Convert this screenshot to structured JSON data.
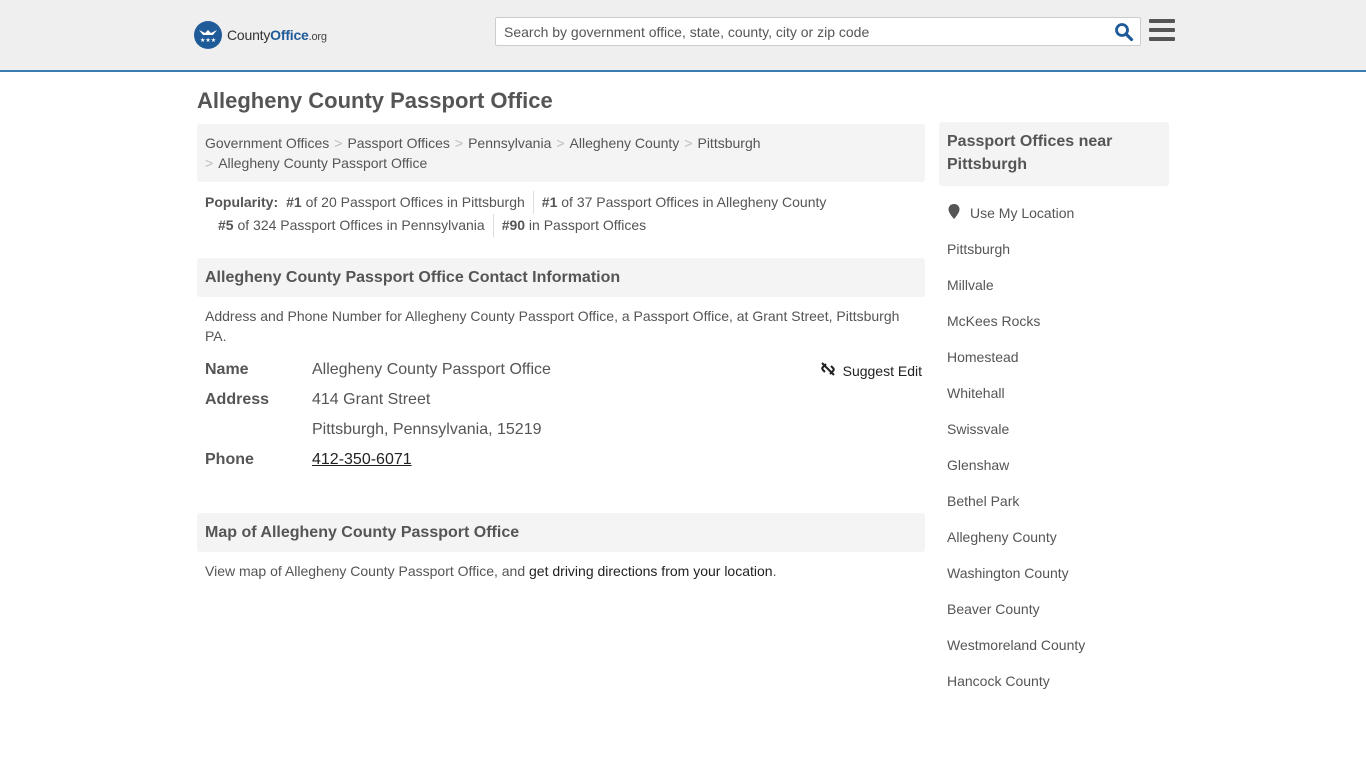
{
  "header": {
    "logo": {
      "prefix": "County",
      "bold": "Office",
      "tld": ".org"
    },
    "search_placeholder": "Search by government office, state, county, city or zip code",
    "search_value": "",
    "search_icon": "search-icon",
    "menu_icon": "hamburger-menu-icon",
    "accent_color": "#3a7bb0"
  },
  "page": {
    "title": "Allegheny County Passport Office"
  },
  "breadcrumb": [
    "Government Offices",
    "Passport Offices",
    "Pennsylvania",
    "Allegheny County",
    "Pittsburgh",
    "Allegheny County Passport Office"
  ],
  "popularity": {
    "label": "Popularity:",
    "items": [
      {
        "rank": "#1",
        "text": " of 20 Passport Offices in Pittsburgh"
      },
      {
        "rank": "#1",
        "text": " of 37 Passport Offices in Allegheny County"
      },
      {
        "rank": "#5",
        "text": " of 324 Passport Offices in Pennsylvania"
      },
      {
        "rank": "#90",
        "text": " in Passport Offices"
      }
    ]
  },
  "contact": {
    "heading": "Allegheny County Passport Office Contact Information",
    "description": "Address and Phone Number for Allegheny County Passport Office, a Passport Office, at Grant Street, Pittsburgh PA.",
    "suggest_edit": "Suggest Edit",
    "rows": {
      "name_label": "Name",
      "name_value": "Allegheny County Passport Office",
      "address_label": "Address",
      "address_line1": "414 Grant Street",
      "address_line2": "Pittsburgh, Pennsylvania, 15219",
      "phone_label": "Phone",
      "phone_value": "412-350-6071"
    }
  },
  "map": {
    "heading": "Map of Allegheny County Passport Office",
    "text_before": "View map of Allegheny County Passport Office, and ",
    "link": "get driving directions from your location",
    "text_after": "."
  },
  "sidebar": {
    "heading": "Passport Offices near Pittsburgh",
    "use_location": "Use My Location",
    "links": [
      "Pittsburgh",
      "Millvale",
      "McKees Rocks",
      "Homestead",
      "Whitehall",
      "Swissvale",
      "Glenshaw",
      "Bethel Park",
      "Allegheny County",
      "Washington County",
      "Beaver County",
      "Westmoreland County",
      "Hancock County"
    ]
  }
}
